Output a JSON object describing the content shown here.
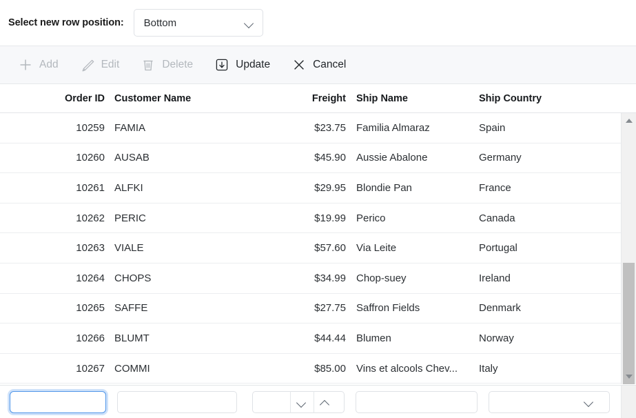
{
  "position_bar": {
    "label": "Select new row position:",
    "select": {
      "value": "Bottom",
      "icon": "chevron-down-icon"
    }
  },
  "toolbar": {
    "items": [
      {
        "label": "Add",
        "icon": "plus-icon",
        "enabled": false
      },
      {
        "label": "Edit",
        "icon": "pencil-icon",
        "enabled": false
      },
      {
        "label": "Delete",
        "icon": "trash-icon",
        "enabled": false
      },
      {
        "label": "Update",
        "icon": "update-box-arrow-icon",
        "enabled": true
      },
      {
        "label": "Cancel",
        "icon": "close-x-icon",
        "enabled": true
      }
    ]
  },
  "grid": {
    "columns": [
      {
        "key": "order_id",
        "label": "Order ID",
        "align": "right"
      },
      {
        "key": "customer",
        "label": "Customer Name",
        "align": "left"
      },
      {
        "key": "freight",
        "label": "Freight",
        "align": "right"
      },
      {
        "key": "ship_name",
        "label": "Ship Name",
        "align": "left"
      },
      {
        "key": "ship_country",
        "label": "Ship Country",
        "align": "left"
      }
    ],
    "rows": [
      {
        "order_id": "10259",
        "customer": "FAMIA",
        "freight": "$23.75",
        "ship_name": "Familia Almaraz",
        "ship_country": "Spain"
      },
      {
        "order_id": "10260",
        "customer": "AUSAB",
        "freight": "$45.90",
        "ship_name": "Aussie Abalone",
        "ship_country": "Germany"
      },
      {
        "order_id": "10261",
        "customer": "ALFKI",
        "freight": "$29.95",
        "ship_name": "Blondie Pan",
        "ship_country": "France"
      },
      {
        "order_id": "10262",
        "customer": "PERIC",
        "freight": "$19.99",
        "ship_name": "Perico",
        "ship_country": "Canada"
      },
      {
        "order_id": "10263",
        "customer": "VIALE",
        "freight": "$57.60",
        "ship_name": "Via Leite",
        "ship_country": "Portugal"
      },
      {
        "order_id": "10264",
        "customer": "CHOPS",
        "freight": "$34.99",
        "ship_name": "Chop-suey",
        "ship_country": "Ireland"
      },
      {
        "order_id": "10265",
        "customer": "SAFFE",
        "freight": "$27.75",
        "ship_name": "Saffron Fields",
        "ship_country": "Denmark"
      },
      {
        "order_id": "10266",
        "customer": "BLUMT",
        "freight": "$44.44",
        "ship_name": "Blumen",
        "ship_country": "Norway"
      },
      {
        "order_id": "10267",
        "customer": "COMMI",
        "freight": "$85.00",
        "ship_name": "Vins et alcools Chev...",
        "ship_country": "Italy"
      }
    ],
    "scrollbar": {
      "up_icon": "scroll-up-arrow-icon",
      "down_icon": "scroll-down-arrow-icon"
    }
  },
  "edit_row": {
    "fields": [
      {
        "name": "order-id",
        "value": "",
        "placeholder": "",
        "focused": true
      },
      {
        "name": "customer",
        "value": "",
        "placeholder": "",
        "focused": false
      },
      {
        "name": "freight",
        "value": "",
        "placeholder": "",
        "focused": false
      },
      {
        "name": "ship-name",
        "value": "",
        "placeholder": "",
        "focused": false
      },
      {
        "name": "ship-country",
        "value": "",
        "placeholder": "",
        "focused": false
      }
    ],
    "spinner": {
      "down_icon": "chevron-down-icon",
      "up_icon": "chevron-up-icon"
    },
    "country_dropdown_icon": "chevron-down-icon"
  },
  "colors": {
    "focus_border": "#4d94e8",
    "focus_glow": "#cfe2fa",
    "toolbar_bg": "#f7f8fa",
    "disabled_text": "#b3b8bd",
    "text": "#2b2f33",
    "scroll_thumb": "#c0c0c0"
  }
}
